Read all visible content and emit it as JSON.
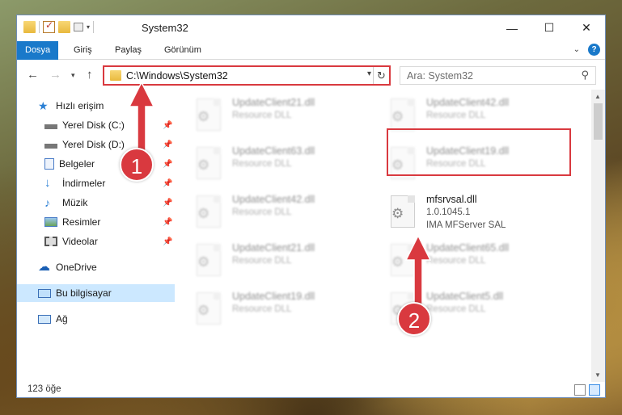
{
  "window": {
    "title": "System32",
    "controls": {
      "minimize": "—",
      "maximize": "☐",
      "close": "✕"
    }
  },
  "ribbon": {
    "tabs": [
      "Dosya",
      "Giriş",
      "Paylaş",
      "Görünüm"
    ],
    "active_tab": "Dosya",
    "expand_icon": "chevron-down-icon",
    "help_label": "?"
  },
  "nav": {
    "address": "C:\\Windows\\System32",
    "search_placeholder": "Ara: System32"
  },
  "sidebar": {
    "items": [
      {
        "label": "Hızlı erişim",
        "icon": "star-icon",
        "pinned": false
      },
      {
        "label": "Yerel Disk (C:)",
        "icon": "drive-icon",
        "pinned": true
      },
      {
        "label": "Yerel Disk (D:)",
        "icon": "drive-icon",
        "pinned": true
      },
      {
        "label": "Belgeler",
        "icon": "document-icon",
        "pinned": true
      },
      {
        "label": "İndirmeler",
        "icon": "download-icon",
        "pinned": true
      },
      {
        "label": "Müzik",
        "icon": "music-icon",
        "pinned": true
      },
      {
        "label": "Resimler",
        "icon": "pictures-icon",
        "pinned": true
      },
      {
        "label": "Videolar",
        "icon": "video-icon",
        "pinned": true
      },
      {
        "label": "OneDrive",
        "icon": "cloud-icon",
        "pinned": false
      },
      {
        "label": "Bu bilgisayar",
        "icon": "computer-icon",
        "pinned": false,
        "selected": true
      },
      {
        "label": "Ağ",
        "icon": "network-icon",
        "pinned": false
      }
    ]
  },
  "files": {
    "left": [
      {
        "name": "UpdateClient21.dll",
        "type": "Resource DLL"
      },
      {
        "name": "UpdateClient63.dll",
        "type": "Resource DLL"
      },
      {
        "name": "UpdateClient42.dll",
        "type": "Resource DLL"
      },
      {
        "name": "UpdateClient21.dll",
        "type": "Resource DLL"
      },
      {
        "name": "UpdateClient19.dll",
        "type": "Resource DLL"
      }
    ],
    "right": [
      {
        "name": "UpdateClient42.dll",
        "type": "Resource DLL"
      },
      {
        "name": "UpdateClient19.dll",
        "type": "Resource DLL"
      },
      {
        "name": "mfsrvsal.dll",
        "version": "1.0.1045.1",
        "company": "IMA MFServer SAL",
        "highlighted": true
      },
      {
        "name": "UpdateClient65.dll",
        "type": "Resource DLL"
      },
      {
        "name": "UpdateClient5.dll",
        "type": "Resource DLL"
      }
    ]
  },
  "status": {
    "item_count": "123 öğe"
  },
  "annotations": {
    "badge1": "1",
    "badge2": "2",
    "color": "#d9393f"
  }
}
